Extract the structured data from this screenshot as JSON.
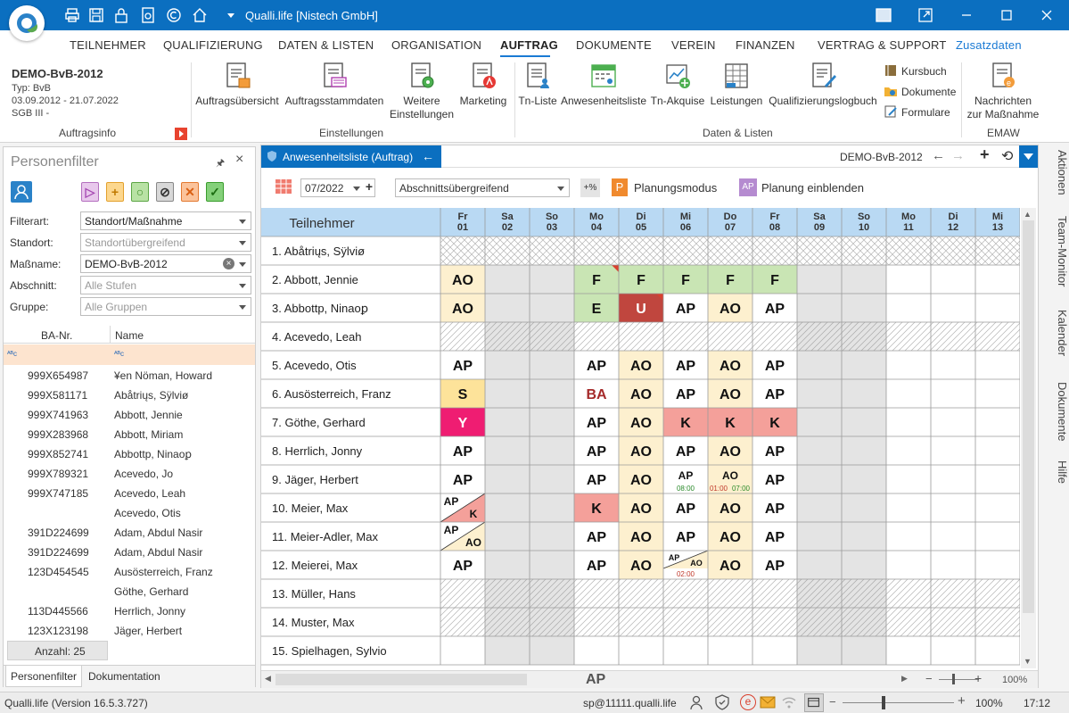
{
  "app": {
    "title": "Qualli.life [Nistech GmbH]"
  },
  "menu_tabs": [
    "TEILNEHMER",
    "QUALIFIZIERUNG",
    "DATEN & LISTEN",
    "ORGANISATION",
    "AUFTRAG",
    "DOKUMENTE",
    "VEREIN",
    "FINANZEN",
    "VERTRAG & SUPPORT",
    "Zusatzdaten"
  ],
  "active_tab": "AUFTRAG",
  "auftragsinfo": {
    "name": "DEMO-BvB-2012",
    "typ": "Typ: BvB",
    "zeitraum": "03.09.2012 - 21.07.2022",
    "sgb": "SGB III -",
    "group_label": "Auftragsinfo"
  },
  "ribbon": {
    "einstellungen": {
      "label": "Einstellungen",
      "buttons": [
        "Auftragsübersicht",
        "Auftragsstammdaten",
        "Weitere",
        "Einstellungen",
        "Marketing"
      ]
    },
    "daten_listen": {
      "label": "Daten & Listen",
      "buttons": [
        "Tn-Liste",
        "Anwesenheitsliste",
        "Tn-Akquise",
        "Leistungen",
        "Qualifizierungslogbuch"
      ],
      "small_buttons": [
        "Kursbuch",
        "Dokumente",
        "Formulare"
      ]
    },
    "emaw": {
      "label": "EMAW",
      "button_line1": "Nachrichten",
      "button_line2": "zur Maßnahme"
    }
  },
  "personenfilter": {
    "title": "Personenfilter",
    "filters": [
      {
        "label": "Filterart:",
        "value": "Standort/Maßnahme",
        "placeholder": false
      },
      {
        "label": "Standort:",
        "value": "Standortübergreifend",
        "placeholder": true
      },
      {
        "label": "Maßname:",
        "value": "DEMO-BvB-2012",
        "placeholder": false
      },
      {
        "label": "Abschnitt:",
        "value": "Alle Stufen",
        "placeholder": true
      },
      {
        "label": "Gruppe:",
        "value": "Alle Gruppen",
        "placeholder": true
      }
    ],
    "columns": [
      "BA-Nr.",
      "Name"
    ],
    "rows": [
      [
        "999X654987",
        "¥en Nöman, Howard"
      ],
      [
        "999X581171",
        "Abåtriųs, Sÿlviø"
      ],
      [
        "999X741963",
        "Abbott, Jennie"
      ],
      [
        "999X283968",
        "Abbott, Miriam"
      ],
      [
        "999X852741",
        "Abbottp, Ninaoꝑ"
      ],
      [
        "999X789321",
        "Acevedo, Jo"
      ],
      [
        "999X747185",
        "Acevedo, Leah"
      ],
      [
        "",
        "Acevedo, Otis"
      ],
      [
        "391D224699",
        "Adam, Abdul Nasir"
      ],
      [
        "391D224699",
        "Adam, Abdul Nasir"
      ],
      [
        "123D454545",
        "Ausösterreich, Franz"
      ],
      [
        "",
        "Göthe, Gerhard"
      ],
      [
        "113D445566",
        "Herrlich, Jonny"
      ],
      [
        "123X123198",
        "Jäger, Herbert"
      ]
    ],
    "count": "Anzahl: 25",
    "tabs": [
      "Personenfilter",
      "Dokumentation"
    ]
  },
  "anwesenheit": {
    "tab_title": "Anwesenheitsliste (Auftrag)",
    "auftrag": "DEMO-BvB-2012",
    "month": "07/2022",
    "abschnitt": "Abschnittsübergreifend",
    "percent_btn": "+%",
    "planungsmodus": "Planungsmodus",
    "planung_einblenden": "Planung einblenden",
    "teilnehmer_header": "Teilnehmer",
    "days": [
      {
        "wd": "Fr",
        "d": "01",
        "weekend": false
      },
      {
        "wd": "Sa",
        "d": "02",
        "weekend": true
      },
      {
        "wd": "So",
        "d": "03",
        "weekend": true
      },
      {
        "wd": "Mo",
        "d": "04",
        "weekend": false
      },
      {
        "wd": "Di",
        "d": "05",
        "weekend": false
      },
      {
        "wd": "Mi",
        "d": "06",
        "weekend": false
      },
      {
        "wd": "Do",
        "d": "07",
        "weekend": false
      },
      {
        "wd": "Fr",
        "d": "08",
        "weekend": false
      },
      {
        "wd": "Sa",
        "d": "09",
        "weekend": true
      },
      {
        "wd": "So",
        "d": "10",
        "weekend": true
      },
      {
        "wd": "Mo",
        "d": "11",
        "weekend": false
      },
      {
        "wd": "Di",
        "d": "12",
        "weekend": false
      },
      {
        "wd": "Mi",
        "d": "13",
        "weekend": false
      }
    ],
    "legend_code": "AP",
    "zoom": "100%",
    "participants": [
      {
        "name": "1. Abåtriųs, Sÿlviø",
        "pattern": "cross",
        "cells": [
          null,
          null,
          null,
          null,
          null,
          null,
          null,
          null,
          null,
          null,
          null,
          null,
          null
        ]
      },
      {
        "name": "2. Abbott, Jennie",
        "pattern": null,
        "cells": [
          {
            "t": "AO",
            "bg": "#fdf0cf"
          },
          null,
          null,
          {
            "t": "F",
            "bg": "#c9e5b4",
            "flag": true
          },
          {
            "t": "F",
            "bg": "#c9e5b4"
          },
          {
            "t": "F",
            "bg": "#c9e5b4"
          },
          {
            "t": "F",
            "bg": "#c9e5b4"
          },
          {
            "t": "F",
            "bg": "#c9e5b4"
          },
          null,
          null,
          null,
          null,
          null
        ]
      },
      {
        "name": "3. Abbottp, Ninaoꝑ",
        "pattern": null,
        "cells": [
          {
            "t": "AO",
            "bg": "#fdf0cf"
          },
          null,
          null,
          {
            "t": "E",
            "bg": "#c9e5b4"
          },
          {
            "t": "U",
            "bg": "#c0463e",
            "fg": "#ffffff",
            "flag": true
          },
          {
            "t": "AP",
            "bg": "#ffffff"
          },
          {
            "t": "AO",
            "bg": "#fdf0cf"
          },
          {
            "t": "AP",
            "bg": "#ffffff"
          },
          null,
          null,
          null,
          null,
          null
        ]
      },
      {
        "name": "4. Acevedo, Leah",
        "pattern": "diag",
        "cells": [
          null,
          null,
          null,
          null,
          null,
          null,
          null,
          null,
          null,
          null,
          null,
          null,
          null
        ]
      },
      {
        "name": "5. Acevedo, Otis",
        "pattern": null,
        "cells": [
          {
            "t": "AP",
            "bg": "#ffffff"
          },
          null,
          null,
          {
            "t": "AP",
            "bg": "#ffffff"
          },
          {
            "t": "AO",
            "bg": "#fdf0cf"
          },
          {
            "t": "AP",
            "bg": "#ffffff"
          },
          {
            "t": "AO",
            "bg": "#fdf0cf"
          },
          {
            "t": "AP",
            "bg": "#ffffff"
          },
          null,
          null,
          null,
          null,
          null
        ]
      },
      {
        "name": "6. Ausösterreich, Franz",
        "pattern": null,
        "cells": [
          {
            "t": "S",
            "bg": "#fde39a"
          },
          null,
          null,
          {
            "t": "BA",
            "bg": "#ffffff",
            "fg": "#a52a2a"
          },
          {
            "t": "AO",
            "bg": "#fdf0cf"
          },
          {
            "t": "AP",
            "bg": "#ffffff"
          },
          {
            "t": "AO",
            "bg": "#fdf0cf"
          },
          {
            "t": "AP",
            "bg": "#ffffff"
          },
          null,
          null,
          null,
          null,
          null
        ]
      },
      {
        "name": "7. Göthe, Gerhard",
        "pattern": null,
        "cells": [
          {
            "t": "Y",
            "bg": "#ef1d72",
            "fg": "#ffffff"
          },
          null,
          null,
          {
            "t": "AP",
            "bg": "#ffffff"
          },
          {
            "t": "AO",
            "bg": "#fdf0cf"
          },
          {
            "t": "K",
            "bg": "#f4a09a"
          },
          {
            "t": "K",
            "bg": "#f4a09a"
          },
          {
            "t": "K",
            "bg": "#f4a09a"
          },
          null,
          null,
          null,
          null,
          null
        ]
      },
      {
        "name": "8. Herrlich, Jonny",
        "pattern": null,
        "cells": [
          {
            "t": "AP",
            "bg": "#ffffff"
          },
          null,
          null,
          {
            "t": "AP",
            "bg": "#ffffff"
          },
          {
            "t": "AO",
            "bg": "#fdf0cf"
          },
          {
            "t": "AP",
            "bg": "#ffffff"
          },
          {
            "t": "AO",
            "bg": "#fdf0cf"
          },
          {
            "t": "AP",
            "bg": "#ffffff"
          },
          null,
          null,
          null,
          null,
          null
        ]
      },
      {
        "name": "9. Jäger, Herbert",
        "pattern": null,
        "cells": [
          {
            "t": "AP",
            "bg": "#ffffff"
          },
          null,
          null,
          {
            "t": "AP",
            "bg": "#ffffff"
          },
          {
            "t": "AO",
            "bg": "#fdf0cf"
          },
          {
            "t": "AP",
            "bg": "#ffffff",
            "sub": [
              "08:00"
            ],
            "subc": [
              "#2a8a2a"
            ]
          },
          {
            "t": "AO",
            "bg": "#fdf0cf",
            "sub": [
              "01:00",
              "07:00"
            ],
            "subc": [
              "#c0392b",
              "#2a8a2a"
            ]
          },
          {
            "t": "AP",
            "bg": "#ffffff"
          },
          null,
          null,
          null,
          null,
          null
        ]
      },
      {
        "name": "10. Meier, Max",
        "pattern": null,
        "cells": [
          {
            "split": [
              "AP",
              "K"
            ],
            "bg2": "#f4a09a"
          },
          null,
          null,
          {
            "t": "K",
            "bg": "#f4a09a"
          },
          {
            "t": "AO",
            "bg": "#fdf0cf"
          },
          {
            "t": "AP",
            "bg": "#ffffff"
          },
          {
            "t": "AO",
            "bg": "#fdf0cf"
          },
          {
            "t": "AP",
            "bg": "#ffffff"
          },
          null,
          null,
          null,
          null,
          null
        ]
      },
      {
        "name": "11. Meier-Adler, Max",
        "pattern": null,
        "cells": [
          {
            "split": [
              "AP",
              "AO"
            ],
            "bg2": "#fdf0cf"
          },
          null,
          null,
          {
            "t": "AP",
            "bg": "#ffffff"
          },
          {
            "t": "AO",
            "bg": "#fdf0cf"
          },
          {
            "t": "AP",
            "bg": "#ffffff"
          },
          {
            "t": "AO",
            "bg": "#fdf0cf"
          },
          {
            "t": "AP",
            "bg": "#ffffff"
          },
          null,
          null,
          null,
          null,
          null
        ]
      },
      {
        "name": "12. Meierei, Max",
        "pattern": null,
        "cells": [
          {
            "t": "AP",
            "bg": "#ffffff"
          },
          null,
          null,
          {
            "t": "AP",
            "bg": "#ffffff"
          },
          {
            "t": "AO",
            "bg": "#fdf0cf"
          },
          {
            "splitsmall": [
              "AP",
              "AO"
            ],
            "bg2": "#fdf0cf",
            "sub": [
              "02:00"
            ],
            "subc": [
              "#c0392b"
            ]
          },
          {
            "t": "AO",
            "bg": "#fdf0cf"
          },
          {
            "t": "AP",
            "bg": "#ffffff"
          },
          null,
          null,
          null,
          null,
          null
        ]
      },
      {
        "name": "13. Müller, Hans",
        "pattern": "diag",
        "cells": [
          null,
          null,
          null,
          null,
          null,
          null,
          null,
          null,
          null,
          null,
          null,
          null,
          null
        ]
      },
      {
        "name": "14. Muster, Max",
        "pattern": "diag",
        "cells": [
          null,
          null,
          null,
          null,
          null,
          null,
          null,
          null,
          null,
          null,
          null,
          null,
          null
        ]
      },
      {
        "name": "15. Spielhagen, Sylvio",
        "pattern": null,
        "cells": [
          null,
          null,
          null,
          null,
          null,
          null,
          null,
          null,
          null,
          null,
          null,
          null,
          null
        ]
      }
    ]
  },
  "rightbar": [
    "Aktionen",
    "Team-Monitor",
    "Kalender",
    "Dokumente",
    "Hilfe"
  ],
  "statusbar": {
    "version": "Qualli.life (Version 16.5.3.727)",
    "user": "sp@11111.qualli.life",
    "zoom": "100%",
    "time": "17:12"
  },
  "colors": {
    "title_blue": "#0b6fc0",
    "header_blue": "#b9d9f3",
    "weekend_gray": "#e4e4e4",
    "filter_row": "#fde4cf"
  }
}
